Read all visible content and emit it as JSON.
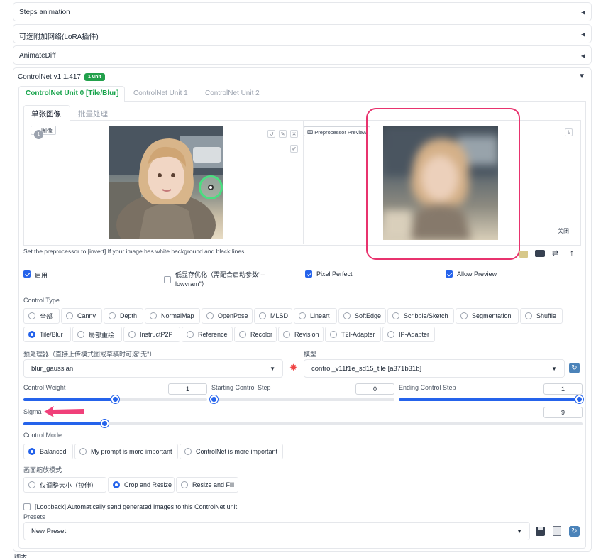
{
  "accordions": {
    "steps": "Steps animation",
    "lora": "可选附加网络(LoRA插件)",
    "animatediff": "AnimateDiff",
    "controlnet": "ControlNet v1.1.417",
    "controlnet_badge": "1 unit"
  },
  "unit_tabs": [
    "ControlNet Unit 0 [Tile/Blur]",
    "ControlNet Unit 1",
    "ControlNet Unit 2"
  ],
  "image_tabs": [
    "单张图像",
    "批量处理"
  ],
  "image_panel": {
    "label": "图像",
    "badge_text": "1",
    "preview_label": "Preprocessor Preview",
    "close": "关闭"
  },
  "hint": "Set the preprocessor to [invert] If your image has white background and black lines.",
  "options": {
    "enable": "启用",
    "low_vram": "低显存优化（需配合启动参数\"--lowvram\"）",
    "pixel_perfect": "Pixel Perfect",
    "allow_preview": "Allow Preview"
  },
  "control_type": {
    "label": "Control Type",
    "row1": [
      "全部",
      "Canny",
      "Depth",
      "NormalMap",
      "OpenPose",
      "MLSD",
      "Lineart",
      "SoftEdge",
      "Scribble/Sketch",
      "Segmentation",
      "Shuffle"
    ],
    "row2": [
      "Tile/Blur",
      "局部重绘",
      "InstructP2P",
      "Reference",
      "Recolor",
      "Revision",
      "T2I-Adapter",
      "IP-Adapter"
    ],
    "selected": "Tile/Blur"
  },
  "preprocessor": {
    "label": "预处理器（直接上传模式图或草稿时可选\"无\"）",
    "value": "blur_gaussian"
  },
  "model": {
    "label": "模型",
    "value": "control_v11f1e_sd15_tile [a371b31b]"
  },
  "sliders": {
    "control_weight": {
      "label": "Control Weight",
      "value": "1",
      "fraction": 0.5
    },
    "start_step": {
      "label": "Starting Control Step",
      "value": "0",
      "fraction": 0.0
    },
    "end_step": {
      "label": "Ending Control Step",
      "value": "1",
      "fraction": 1.0
    },
    "sigma": {
      "label": "Sigma",
      "value": "9",
      "fraction": 0.14
    }
  },
  "control_mode": {
    "label": "Control Mode",
    "options": [
      "Balanced",
      "My prompt is more important",
      "ControlNet is more important"
    ],
    "selected": "Balanced"
  },
  "resize_mode": {
    "label": "画面缩放模式",
    "options": [
      "仅调整大小（拉伸）",
      "Crop and Resize",
      "Resize and Fill"
    ],
    "selected": "Crop and Resize"
  },
  "loopback": "[Loopback] Automatically send generated images to this ControlNet unit",
  "presets": {
    "label": "Presets",
    "value": "New Preset"
  },
  "footer": "脚本",
  "colors": {
    "accent": "#2563eb",
    "tab_active": "#16a34a",
    "badge": "#22a04b",
    "highlight_box": "#e8336e",
    "arrow": "#f0407a"
  }
}
